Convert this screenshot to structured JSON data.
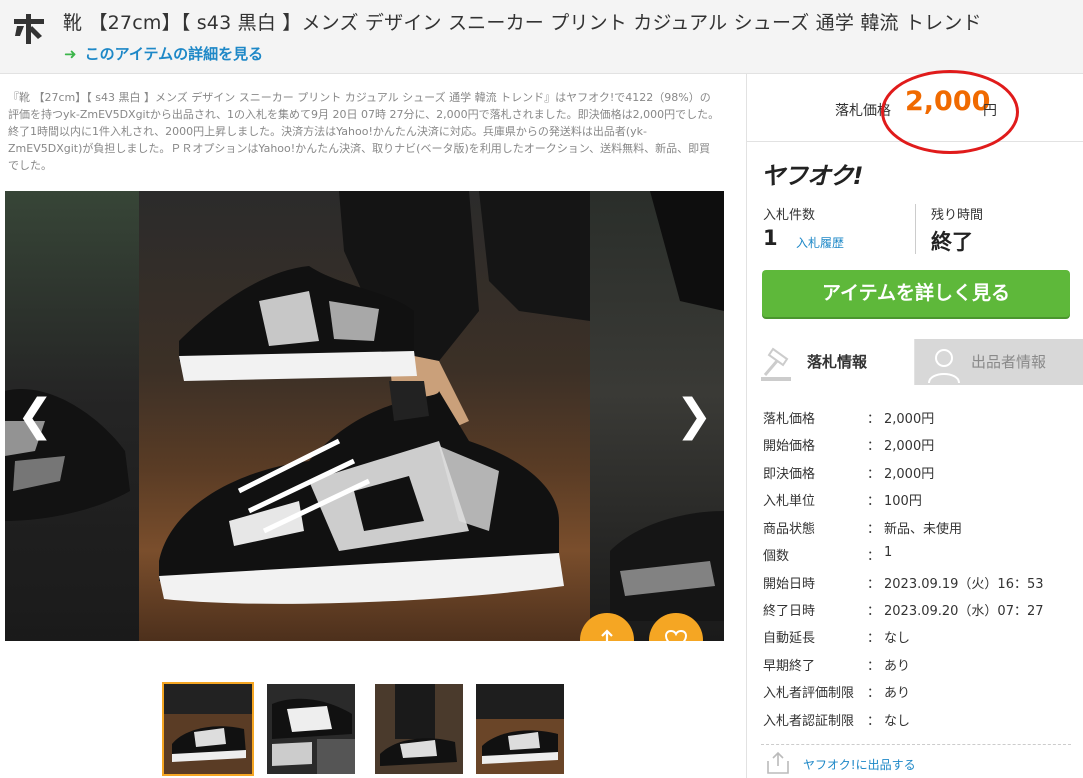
{
  "header": {
    "title": "靴 【27cm】【 s43 黒白 】メンズ デザイン スニーカー プリント カジュアル シューズ 通学 韓流 トレンド",
    "detail_link": "このアイテムの詳細を見る",
    "detail_arrow": "➜"
  },
  "description": "『靴 【27cm】【 s43 黒白 】メンズ デザイン スニーカー プリント カジュアル シューズ 通学 韓流 トレンド』はヤフオク!で4122（98%）の評価を持つyk-ZmEV5DXgitから出品され、1の入札を集めて9月 20日 07時 27分に、2,000円で落札されました。即決価格は2,000円でした。終了1時間以内に1件入札され、2000円上昇しました。決済方法はYahoo!かんたん決済に対応。兵庫県からの発送料は出品者(yk-ZmEV5DXgit)が負担しました。ＰＲオプションはYahoo!かんたん決済、取りナビ(ベータ版)を利用したオークション、送料無料、新品、即買でした。",
  "gallery": {
    "prev": "❮",
    "next": "❯"
  },
  "price": {
    "label": "落札価格",
    "value": "2,000",
    "unit": "円"
  },
  "panel": {
    "logo": "ヤフオク!",
    "bid_count_label": "入札件数",
    "bid_count": "1",
    "bid_history": "入札履歴",
    "remain_label": "残り時間",
    "remain_value": "終了",
    "cta": "アイテムを詳しく見る",
    "tab_info": "落札情報",
    "tab_seller": "出品者情報",
    "sell_link": "ヤフオク!に出品する"
  },
  "info": [
    {
      "k": "落札価格",
      "v": "2,000円"
    },
    {
      "k": "開始価格",
      "v": "2,000円"
    },
    {
      "k": "即決価格",
      "v": "2,000円"
    },
    {
      "k": "入札単位",
      "v": "100円"
    },
    {
      "k": "商品状態",
      "v": "新品、未使用"
    },
    {
      "k": "個数",
      "v": "1"
    },
    {
      "k": "開始日時",
      "v": "2023.09.19（火）16：53"
    },
    {
      "k": "終了日時",
      "v": "2023.09.20（水）07：27"
    },
    {
      "k": "自動延長",
      "v": "なし"
    },
    {
      "k": "早期終了",
      "v": "あり"
    },
    {
      "k": "入札者評価制限",
      "v": "あり"
    },
    {
      "k": "入札者認証制限",
      "v": "なし"
    }
  ],
  "colon": "：",
  "colors": {
    "accent_orange": "#f5a623",
    "price": "#f06a00",
    "cta_green": "#5eb83a",
    "link_blue": "#1e88c7",
    "highlight_red": "#e01b1b"
  }
}
